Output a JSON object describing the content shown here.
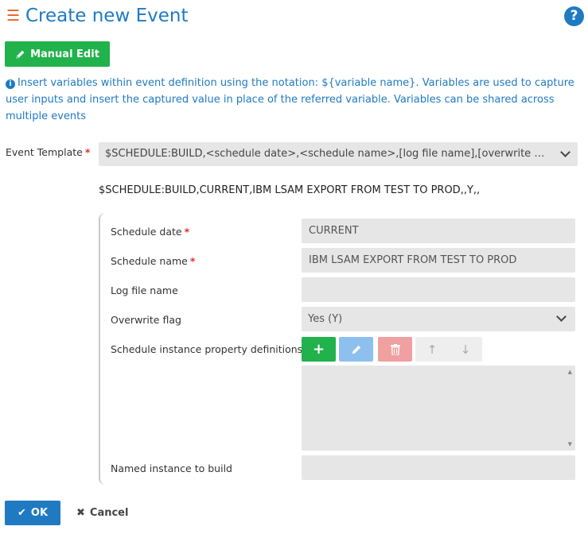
{
  "header": {
    "menu_icon": "hamburger-icon",
    "title": "Create new Event",
    "help_icon": "question-icon",
    "help_glyph": "?"
  },
  "toolbar": {
    "manual_edit_label": "Manual Edit",
    "manual_edit_icon": "pencil-icon"
  },
  "info": {
    "icon": "info-icon",
    "icon_glyph": "i",
    "text": "Insert variables within event definition using the notation: ${variable name}. Variables are used to capture user inputs and insert the captured value in place of the referred variable. Variables can be shared across multiple events"
  },
  "template": {
    "label": "Event Template",
    "required_mark": "*",
    "selected": "$SCHEDULE:BUILD,<schedule date>,<schedule name>,[log file name],[overwrite fla...",
    "preview": "$SCHEDULE:BUILD,CURRENT,IBM LSAM EXPORT FROM TEST TO PROD,,Y,,"
  },
  "fields": {
    "schedule_date": {
      "label": "Schedule date",
      "required_mark": "*",
      "value": "CURRENT"
    },
    "schedule_name": {
      "label": "Schedule name",
      "required_mark": "*",
      "value": "IBM LSAM EXPORT FROM TEST TO PROD"
    },
    "log_file_name": {
      "label": "Log file name",
      "value": ""
    },
    "overwrite_flag": {
      "label": "Overwrite flag",
      "value": "Yes (Y)"
    },
    "property_definitions": {
      "label": "Schedule instance property definitions",
      "add_glyph": "+",
      "up_glyph": "↑",
      "down_glyph": "↓",
      "buttons": [
        "plus-icon",
        "pencil-icon",
        "trash-icon",
        "arrow-up-icon",
        "arrow-down-icon"
      ]
    },
    "named_instance": {
      "label": "Named instance to build",
      "value": ""
    }
  },
  "footer": {
    "ok_label": "OK",
    "ok_glyph": "✔",
    "cancel_label": "Cancel",
    "cancel_glyph": "✖"
  },
  "colors": {
    "accent": "#1f7ac2",
    "brand_orange": "#e8612c",
    "success": "#21b24b",
    "edit_disabled": "#8dc0ee",
    "delete_disabled": "#f0a0a0",
    "required": "#e32d2d",
    "field_bg": "#e6e6e6"
  }
}
